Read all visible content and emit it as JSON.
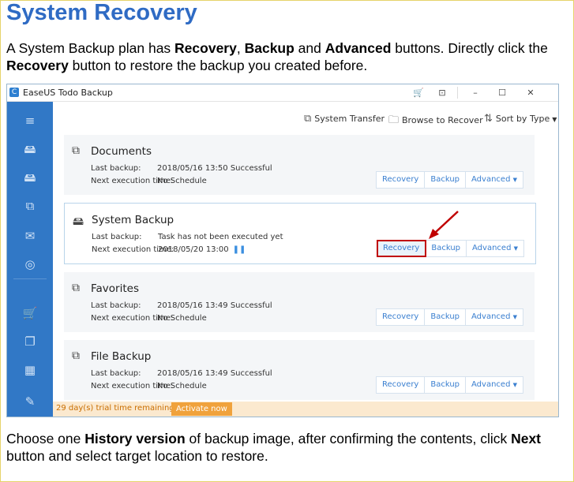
{
  "heading": "System Recovery",
  "intro": {
    "p1": "A System Backup plan has ",
    "b1": "Recovery",
    "p2": ", ",
    "b2": "Backup",
    "p3": " and ",
    "b3": "Advanced",
    "p4": " buttons. Directly click the ",
    "b4": "Recovery",
    "p5": " button to restore the backup you created before."
  },
  "outro": {
    "p1": "Choose one ",
    "b1": "History version",
    "p2": " of backup image, after confirming the contents, click ",
    "b2": "Next",
    "p3": " button and select target location to restore."
  },
  "app": {
    "title": "EaseUS Todo Backup",
    "toolbar": {
      "system_transfer": "System Transfer",
      "browse_to_recover": "Browse to Recover",
      "sort_by_type": "Sort by Type"
    },
    "labels": {
      "last_backup": "Last backup:",
      "next_execution": "Next execution time:"
    },
    "buttons": {
      "recovery": "Recovery",
      "backup": "Backup",
      "advanced": "Advanced"
    },
    "plans": [
      {
        "name": "Documents",
        "last_backup": "2018/05/16 13:50 Successful",
        "next_execution": "No Schedule",
        "icon": "documents-icon"
      },
      {
        "name": "System Backup",
        "last_backup": "Task has not been executed yet",
        "next_execution": "2018/05/20 13:00",
        "icon": "system-backup-icon"
      },
      {
        "name": "Favorites",
        "last_backup": "2018/05/16 13:49 Successful",
        "next_execution": "No Schedule",
        "icon": "favorites-icon"
      },
      {
        "name": "File Backup",
        "last_backup": "2018/05/16 13:49 Successful",
        "next_execution": "No Schedule",
        "icon": "file-backup-icon"
      }
    ],
    "status": {
      "trial": "29 day(s) trial time remaining.",
      "activate": "Activate now"
    },
    "colors": {
      "sidebar": "#3178c6",
      "accent": "#3a7fd0",
      "activate": "#f0a23c",
      "highlight": "#c00000"
    }
  }
}
